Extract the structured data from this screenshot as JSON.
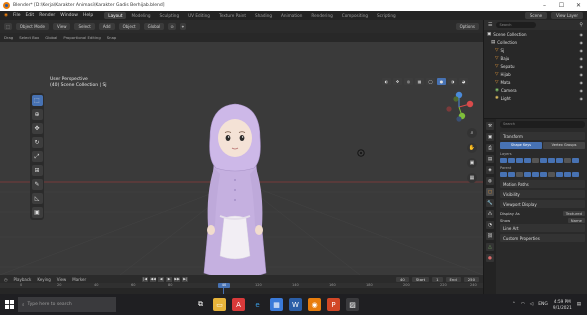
{
  "window": {
    "title": "Blender* [D:\\Kerja\\Karakter Animasi\\Karakter Gadis Berhijab.blend]",
    "controls": [
      "–",
      "☐",
      "✕"
    ]
  },
  "menu": {
    "items": [
      "File",
      "Edit",
      "Render",
      "Window",
      "Help"
    ],
    "workspaces": [
      "Layout",
      "Modeling",
      "Sculpting",
      "UV Editing",
      "Texture Paint",
      "Shading",
      "Animation",
      "Rendering",
      "Compositing",
      "Scripting"
    ],
    "active_workspace": "Layout",
    "right": [
      "Scene",
      "View Layer"
    ]
  },
  "viewport_header": {
    "mode": "Object Mode",
    "view": "View",
    "select": "Select",
    "add": "Add",
    "object": "Object",
    "orientation": "Global",
    "pivot": "⊙",
    "snap": "⌖",
    "overlay": "Options"
  },
  "tool_settings": [
    "Drag",
    "Select Box",
    "Global",
    "Proportional Editing",
    "Snap"
  ],
  "view_label": {
    "line1": "User Perspective",
    "line2": "(40) Scene Collection | Sj"
  },
  "outliner": {
    "search_placeholder": "Search",
    "rows": [
      {
        "indent": 3,
        "icon": "▣",
        "label": "Scene Collection",
        "color": "#dddddd"
      },
      {
        "indent": 7,
        "icon": "▤",
        "label": "Collection",
        "color": "#dddddd"
      },
      {
        "indent": 11,
        "icon": "▽",
        "label": "Sj",
        "color": "#e89a3a"
      },
      {
        "indent": 11,
        "icon": "▽",
        "label": "Baju",
        "color": "#e89a3a"
      },
      {
        "indent": 11,
        "icon": "▽",
        "label": "Sepatu",
        "color": "#e89a3a"
      },
      {
        "indent": 11,
        "icon": "▽",
        "label": "Hijab",
        "color": "#e89a3a"
      },
      {
        "indent": 11,
        "icon": "▽",
        "label": "Mata",
        "color": "#e89a3a"
      },
      {
        "indent": 11,
        "icon": "◉",
        "label": "Camera",
        "color": "#7fbf6a"
      },
      {
        "indent": 11,
        "icon": "✺",
        "label": "Light",
        "color": "#e0c060"
      }
    ]
  },
  "properties": {
    "search_placeholder": "Search",
    "panels_top": [
      "Transform"
    ],
    "segment": [
      "Shape Keys",
      "Vertex Groups"
    ],
    "label_layers": "Layers",
    "label_parent": "Parent",
    "panels_bottom": [
      "Motion Paths",
      "Visibility",
      "Viewport Display",
      "Line Art",
      "Custom Properties"
    ],
    "display_as": {
      "key": "Display As",
      "value": "Textured"
    },
    "show": {
      "key": "Show",
      "value": "Name"
    }
  },
  "timeline": {
    "menu": [
      "Playback",
      "Keying",
      "View",
      "Marker"
    ],
    "play_controls": [
      "|◀",
      "◀◀",
      "◀",
      "▶",
      "▶▶",
      "▶|"
    ],
    "current_frame": "40",
    "start_label": "Start",
    "start": "1",
    "end_label": "End",
    "end": "250",
    "ticks": [
      "0",
      "20",
      "40",
      "60",
      "80",
      "100",
      "120",
      "140",
      "160",
      "180",
      "200",
      "220",
      "240"
    ]
  },
  "taskbar": {
    "search_placeholder": "Type here to search",
    "time": "4:59 PM",
    "date": "9/1/2021",
    "lang": "ENG"
  },
  "colors": {
    "accent": "#4772b3",
    "viewport_bg": "#3a3a3a",
    "character_lilac": "#c7b3e3",
    "apron": "#f2eef4"
  }
}
